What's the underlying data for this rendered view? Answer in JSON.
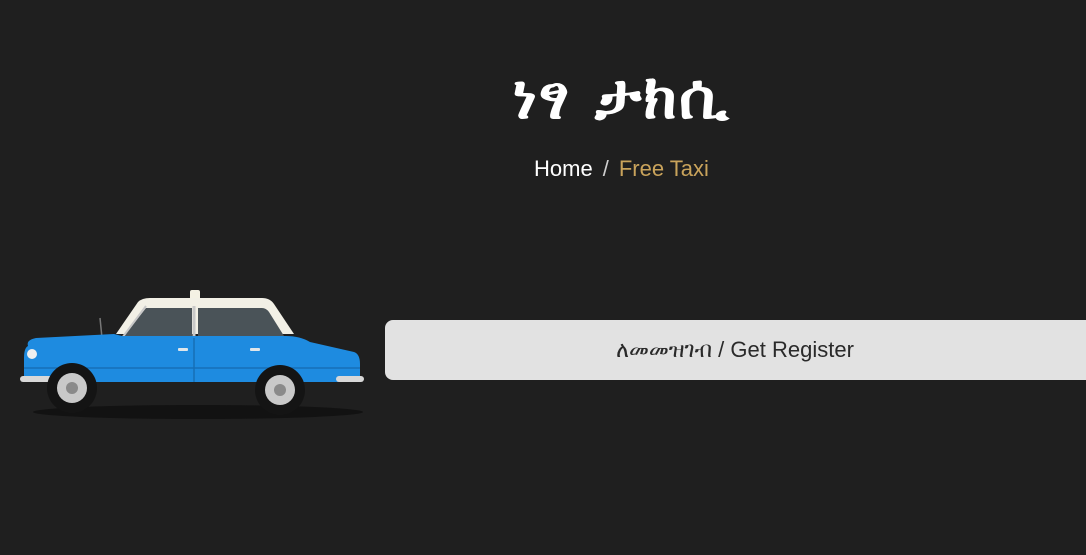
{
  "hero": {
    "title": "ነፃ ታክሲ"
  },
  "breadcrumb": {
    "home": "Home",
    "separator": "/",
    "current": "Free Taxi"
  },
  "register": {
    "label": "ለመመዝገብ / Get Register"
  },
  "colors": {
    "background": "#1f1f1f",
    "accent": "#c9a35b",
    "button_bg": "#e2e2e2",
    "taxi_body": "#1e8be0",
    "taxi_roof": "#f2f0e6"
  },
  "images": {
    "taxi": "taxi-car-icon"
  }
}
